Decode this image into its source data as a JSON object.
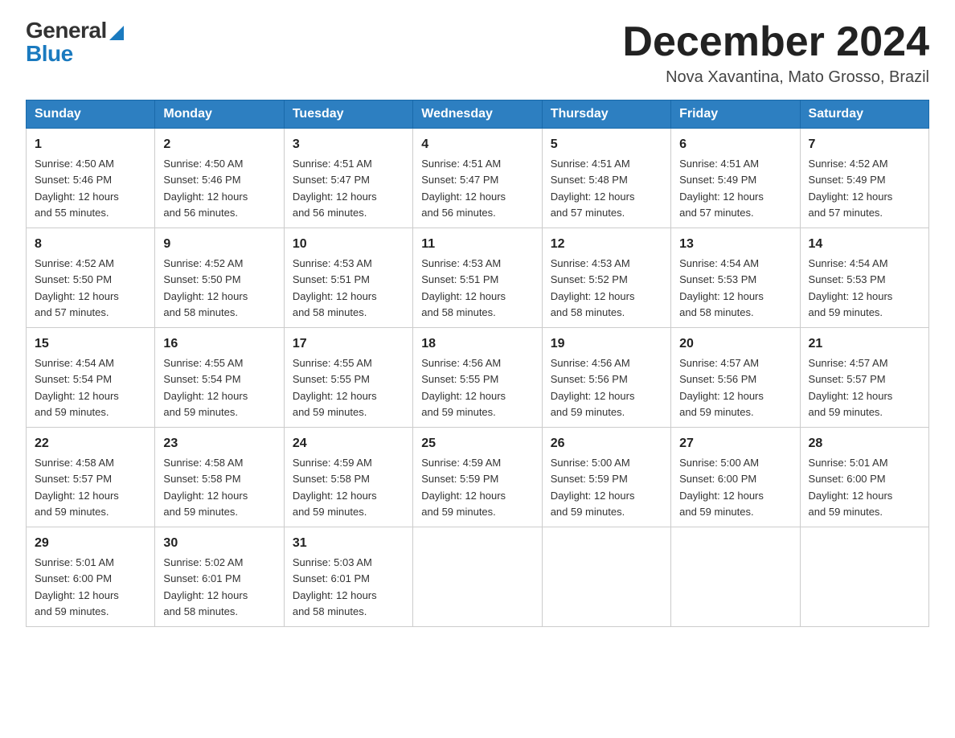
{
  "logo": {
    "general": "General",
    "blue": "Blue",
    "triangle_color": "#1a7abf"
  },
  "header": {
    "month_title": "December 2024",
    "subtitle": "Nova Xavantina, Mato Grosso, Brazil"
  },
  "weekdays": [
    "Sunday",
    "Monday",
    "Tuesday",
    "Wednesday",
    "Thursday",
    "Friday",
    "Saturday"
  ],
  "weeks": [
    [
      {
        "day": "1",
        "sunrise": "4:50 AM",
        "sunset": "5:46 PM",
        "daylight": "12 hours and 55 minutes."
      },
      {
        "day": "2",
        "sunrise": "4:50 AM",
        "sunset": "5:46 PM",
        "daylight": "12 hours and 56 minutes."
      },
      {
        "day": "3",
        "sunrise": "4:51 AM",
        "sunset": "5:47 PM",
        "daylight": "12 hours and 56 minutes."
      },
      {
        "day": "4",
        "sunrise": "4:51 AM",
        "sunset": "5:47 PM",
        "daylight": "12 hours and 56 minutes."
      },
      {
        "day": "5",
        "sunrise": "4:51 AM",
        "sunset": "5:48 PM",
        "daylight": "12 hours and 57 minutes."
      },
      {
        "day": "6",
        "sunrise": "4:51 AM",
        "sunset": "5:49 PM",
        "daylight": "12 hours and 57 minutes."
      },
      {
        "day": "7",
        "sunrise": "4:52 AM",
        "sunset": "5:49 PM",
        "daylight": "12 hours and 57 minutes."
      }
    ],
    [
      {
        "day": "8",
        "sunrise": "4:52 AM",
        "sunset": "5:50 PM",
        "daylight": "12 hours and 57 minutes."
      },
      {
        "day": "9",
        "sunrise": "4:52 AM",
        "sunset": "5:50 PM",
        "daylight": "12 hours and 58 minutes."
      },
      {
        "day": "10",
        "sunrise": "4:53 AM",
        "sunset": "5:51 PM",
        "daylight": "12 hours and 58 minutes."
      },
      {
        "day": "11",
        "sunrise": "4:53 AM",
        "sunset": "5:51 PM",
        "daylight": "12 hours and 58 minutes."
      },
      {
        "day": "12",
        "sunrise": "4:53 AM",
        "sunset": "5:52 PM",
        "daylight": "12 hours and 58 minutes."
      },
      {
        "day": "13",
        "sunrise": "4:54 AM",
        "sunset": "5:53 PM",
        "daylight": "12 hours and 58 minutes."
      },
      {
        "day": "14",
        "sunrise": "4:54 AM",
        "sunset": "5:53 PM",
        "daylight": "12 hours and 59 minutes."
      }
    ],
    [
      {
        "day": "15",
        "sunrise": "4:54 AM",
        "sunset": "5:54 PM",
        "daylight": "12 hours and 59 minutes."
      },
      {
        "day": "16",
        "sunrise": "4:55 AM",
        "sunset": "5:54 PM",
        "daylight": "12 hours and 59 minutes."
      },
      {
        "day": "17",
        "sunrise": "4:55 AM",
        "sunset": "5:55 PM",
        "daylight": "12 hours and 59 minutes."
      },
      {
        "day": "18",
        "sunrise": "4:56 AM",
        "sunset": "5:55 PM",
        "daylight": "12 hours and 59 minutes."
      },
      {
        "day": "19",
        "sunrise": "4:56 AM",
        "sunset": "5:56 PM",
        "daylight": "12 hours and 59 minutes."
      },
      {
        "day": "20",
        "sunrise": "4:57 AM",
        "sunset": "5:56 PM",
        "daylight": "12 hours and 59 minutes."
      },
      {
        "day": "21",
        "sunrise": "4:57 AM",
        "sunset": "5:57 PM",
        "daylight": "12 hours and 59 minutes."
      }
    ],
    [
      {
        "day": "22",
        "sunrise": "4:58 AM",
        "sunset": "5:57 PM",
        "daylight": "12 hours and 59 minutes."
      },
      {
        "day": "23",
        "sunrise": "4:58 AM",
        "sunset": "5:58 PM",
        "daylight": "12 hours and 59 minutes."
      },
      {
        "day": "24",
        "sunrise": "4:59 AM",
        "sunset": "5:58 PM",
        "daylight": "12 hours and 59 minutes."
      },
      {
        "day": "25",
        "sunrise": "4:59 AM",
        "sunset": "5:59 PM",
        "daylight": "12 hours and 59 minutes."
      },
      {
        "day": "26",
        "sunrise": "5:00 AM",
        "sunset": "5:59 PM",
        "daylight": "12 hours and 59 minutes."
      },
      {
        "day": "27",
        "sunrise": "5:00 AM",
        "sunset": "6:00 PM",
        "daylight": "12 hours and 59 minutes."
      },
      {
        "day": "28",
        "sunrise": "5:01 AM",
        "sunset": "6:00 PM",
        "daylight": "12 hours and 59 minutes."
      }
    ],
    [
      {
        "day": "29",
        "sunrise": "5:01 AM",
        "sunset": "6:00 PM",
        "daylight": "12 hours and 59 minutes."
      },
      {
        "day": "30",
        "sunrise": "5:02 AM",
        "sunset": "6:01 PM",
        "daylight": "12 hours and 58 minutes."
      },
      {
        "day": "31",
        "sunrise": "5:03 AM",
        "sunset": "6:01 PM",
        "daylight": "12 hours and 58 minutes."
      },
      null,
      null,
      null,
      null
    ]
  ],
  "labels": {
    "sunrise": "Sunrise:",
    "sunset": "Sunset:",
    "daylight": "Daylight:"
  }
}
